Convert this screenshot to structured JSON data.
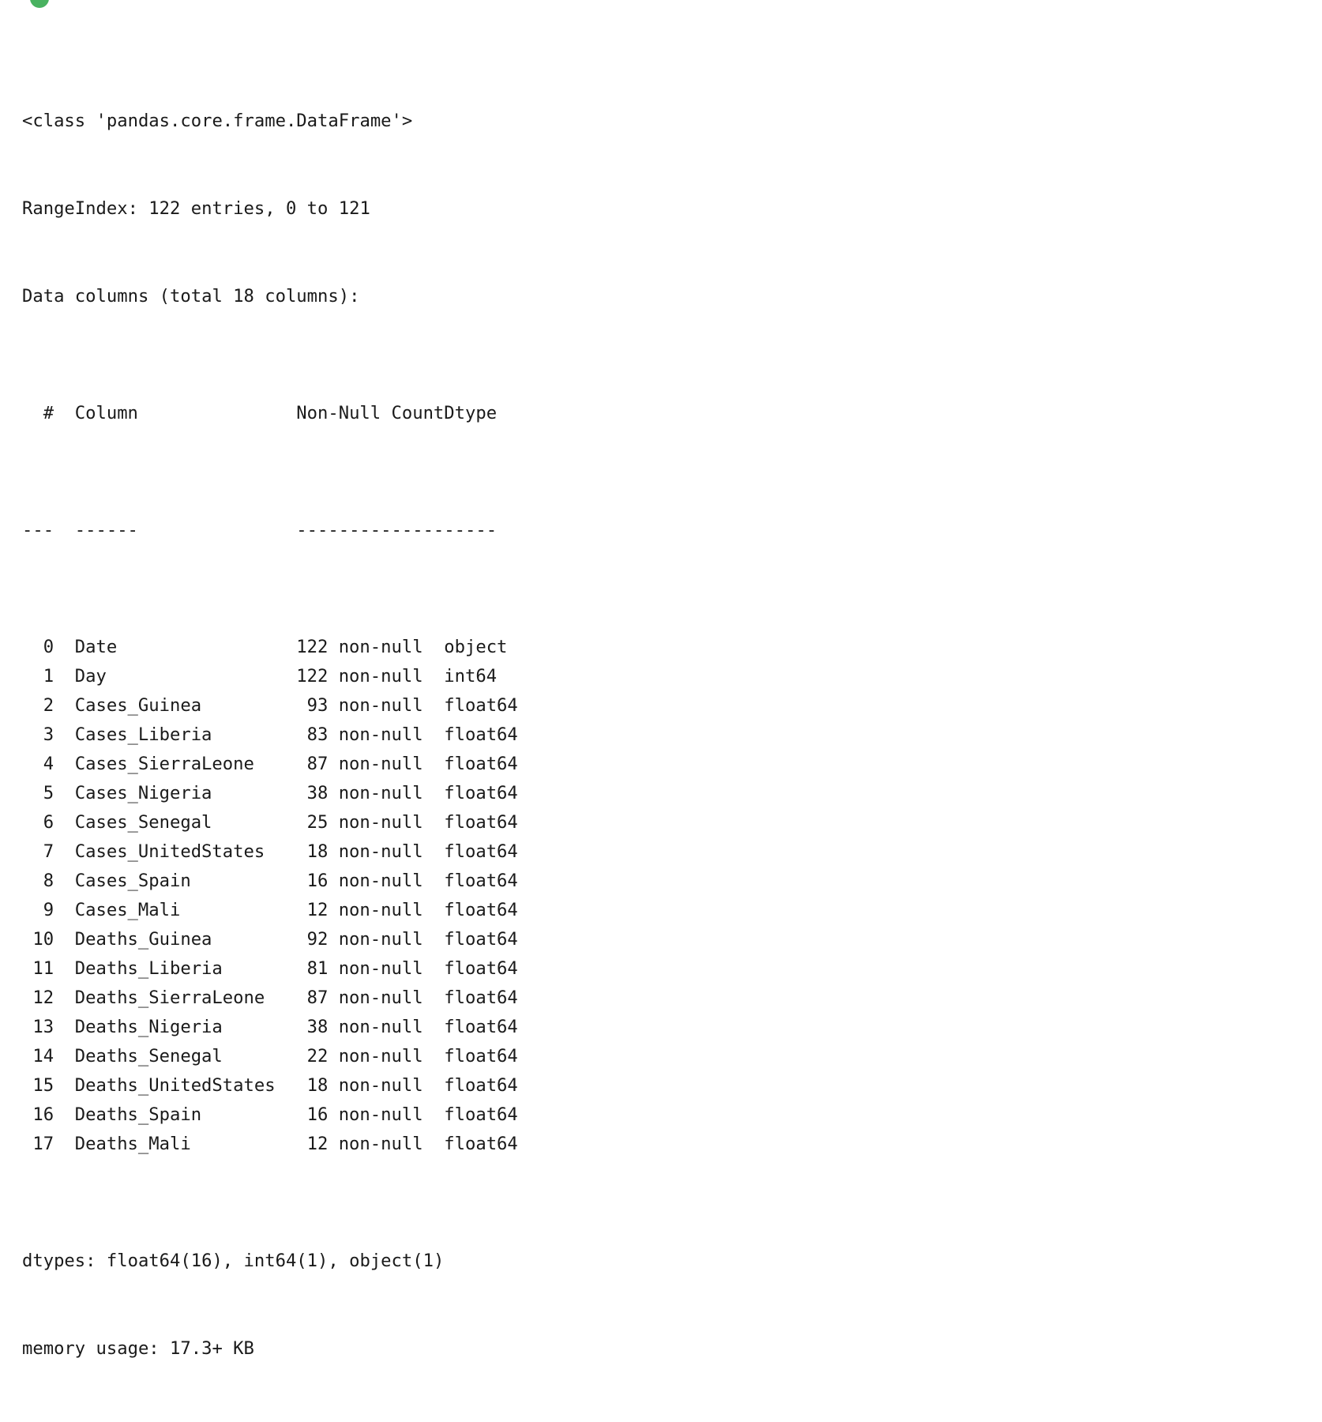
{
  "cell": {
    "status_dot": {
      "name": "execution-success-indicator",
      "color": "#49b260"
    },
    "output_type": "stream"
  },
  "info": {
    "class_line": "<class 'pandas.core.frame.DataFrame'>",
    "range_index_line": "RangeIndex: 122 entries, 0 to 121",
    "data_columns_line": "Data columns (total 18 columns):",
    "entries": 122,
    "index_start": 0,
    "index_end": 121,
    "total_columns": 18,
    "header": {
      "index": "#",
      "column": "Column",
      "non_null_count": "Non-Null Count",
      "dtype": "Dtype"
    },
    "rule": {
      "index": "---",
      "column": "------",
      "non_null_count": "--------------",
      "dtype": "-----"
    },
    "non_null_suffix": "non-null",
    "rows": [
      {
        "index": "0",
        "column": "Date",
        "count": "122",
        "non_null": "non-null",
        "dtype": "object"
      },
      {
        "index": "1",
        "column": "Day",
        "count": "122",
        "non_null": "non-null",
        "dtype": "int64"
      },
      {
        "index": "2",
        "column": "Cases_Guinea",
        "count": "93",
        "non_null": "non-null",
        "dtype": "float64"
      },
      {
        "index": "3",
        "column": "Cases_Liberia",
        "count": "83",
        "non_null": "non-null",
        "dtype": "float64"
      },
      {
        "index": "4",
        "column": "Cases_SierraLeone",
        "count": "87",
        "non_null": "non-null",
        "dtype": "float64"
      },
      {
        "index": "5",
        "column": "Cases_Nigeria",
        "count": "38",
        "non_null": "non-null",
        "dtype": "float64"
      },
      {
        "index": "6",
        "column": "Cases_Senegal",
        "count": "25",
        "non_null": "non-null",
        "dtype": "float64"
      },
      {
        "index": "7",
        "column": "Cases_UnitedStates",
        "count": "18",
        "non_null": "non-null",
        "dtype": "float64"
      },
      {
        "index": "8",
        "column": "Cases_Spain",
        "count": "16",
        "non_null": "non-null",
        "dtype": "float64"
      },
      {
        "index": "9",
        "column": "Cases_Mali",
        "count": "12",
        "non_null": "non-null",
        "dtype": "float64"
      },
      {
        "index": "10",
        "column": "Deaths_Guinea",
        "count": "92",
        "non_null": "non-null",
        "dtype": "float64"
      },
      {
        "index": "11",
        "column": "Deaths_Liberia",
        "count": "81",
        "non_null": "non-null",
        "dtype": "float64"
      },
      {
        "index": "12",
        "column": "Deaths_SierraLeone",
        "count": "87",
        "non_null": "non-null",
        "dtype": "float64"
      },
      {
        "index": "13",
        "column": "Deaths_Nigeria",
        "count": "38",
        "non_null": "non-null",
        "dtype": "float64"
      },
      {
        "index": "14",
        "column": "Deaths_Senegal",
        "count": "22",
        "non_null": "non-null",
        "dtype": "float64"
      },
      {
        "index": "15",
        "column": "Deaths_UnitedStates",
        "count": "18",
        "non_null": "non-null",
        "dtype": "float64"
      },
      {
        "index": "16",
        "column": "Deaths_Spain",
        "count": "16",
        "non_null": "non-null",
        "dtype": "float64"
      },
      {
        "index": "17",
        "column": "Deaths_Mali",
        "count": "12",
        "non_null": "non-null",
        "dtype": "float64"
      }
    ],
    "dtypes_line": "dtypes: float64(16), int64(1), object(1)",
    "memory_usage_line": "memory usage: 17.3+ KB"
  }
}
